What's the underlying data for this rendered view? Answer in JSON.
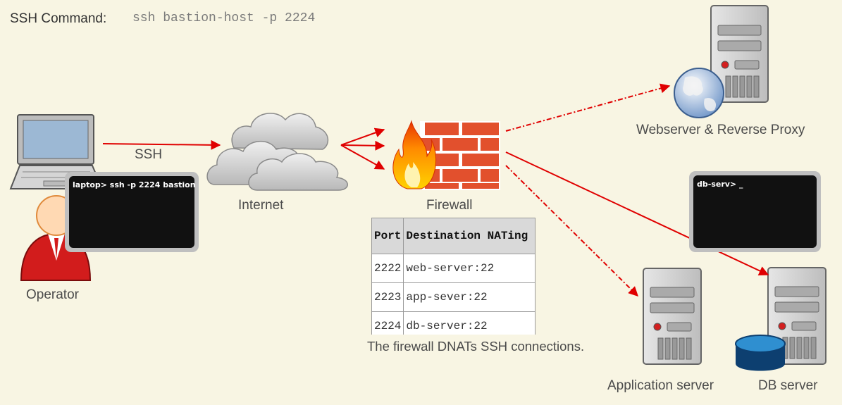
{
  "header": {
    "title": "SSH Command:",
    "command": "ssh bastion-host -p 2224"
  },
  "nodes": {
    "operator": "Operator",
    "internet": "Internet",
    "firewall": "Firewall",
    "webserver": "Webserver & Reverse Proxy",
    "app_server": "Application server",
    "db_server": "DB server"
  },
  "edges": {
    "ssh": "SSH"
  },
  "terminals": {
    "laptop": "laptop> ssh -p 2224 bastion",
    "db": "db-serv> _"
  },
  "nat_table": {
    "headers": [
      "Port",
      "Destination NATing"
    ],
    "rows": [
      [
        "2222",
        "web-server:22"
      ],
      [
        "2223",
        "app-sever:22"
      ],
      [
        "2224",
        "db-server:22"
      ]
    ]
  },
  "caption": "The firewall DNATs SSH connections.",
  "colors": {
    "background": "#f8f5e3",
    "arrow": "#e00000",
    "brick": "#e2502d"
  }
}
